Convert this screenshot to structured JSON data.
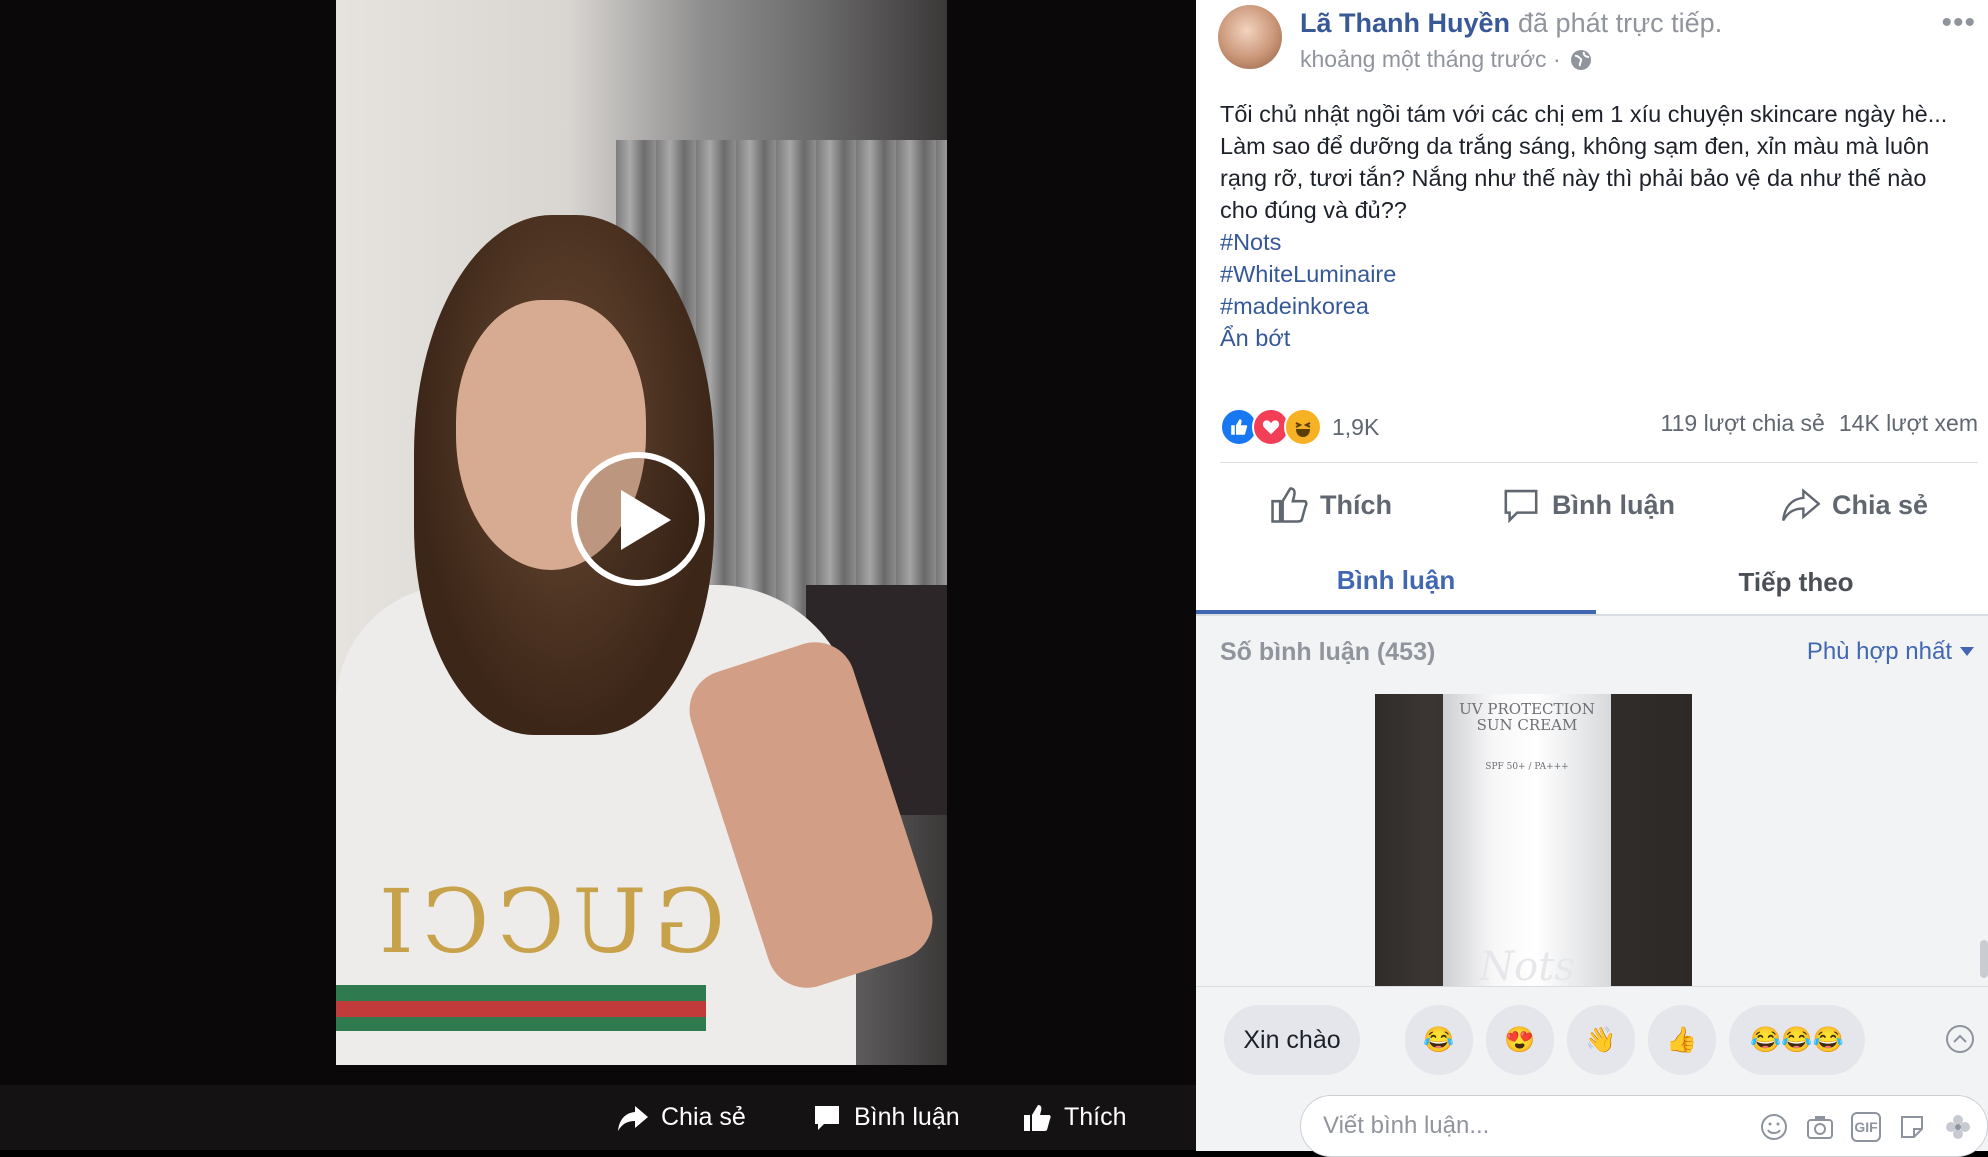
{
  "video": {
    "actions": {
      "share": "Chia sẻ",
      "comment": "Bình luận",
      "like": "Thích"
    },
    "shirt_text": "GUCCI"
  },
  "post": {
    "author": "Lã Thanh Huyền",
    "author_action": "đã phát trực tiếp.",
    "time": "khoảng một tháng trước ·",
    "text": "Tối chủ nhật ngồi tám với các chị em 1 xíu chuyện skincare ngày hè... Làm sao để dưỡng da trắng sáng, không sạm đen, xỉn màu mà luôn rạng rỡ, tươi tắn? Nắng như thế này thì phải bảo vệ da như thế nào cho đúng và đủ??",
    "hashtags": [
      "#Nots",
      "#WhiteLuminaire",
      "#madeinkorea"
    ],
    "see_less": "Ẩn bớt",
    "reaction_count": "1,9K",
    "shares": "119 lượt chia sẻ",
    "views": "14K lượt xem",
    "actions": {
      "like": "Thích",
      "comment": "Bình luận",
      "share": "Chia sẻ"
    }
  },
  "tabs": {
    "comments": "Bình luận",
    "next": "Tiếp theo"
  },
  "comments": {
    "count": "Số bình luận (453)",
    "sort": "Phù hợp nhất",
    "image_text": {
      "line1": "UV PROTECTION",
      "line2": "SUN CREAM",
      "line3": "SPF 50+ / PA+++",
      "brand": "Nots"
    }
  },
  "quick_replies": [
    "Xin chào",
    "😂",
    "😍",
    "👋",
    "👍",
    "😂😂😂"
  ],
  "comment_input": {
    "placeholder": "Viết bình luận...",
    "gif": "GIF"
  },
  "colors": {
    "link": "#385898",
    "accent": "#4267b2",
    "muted": "#90949c"
  }
}
